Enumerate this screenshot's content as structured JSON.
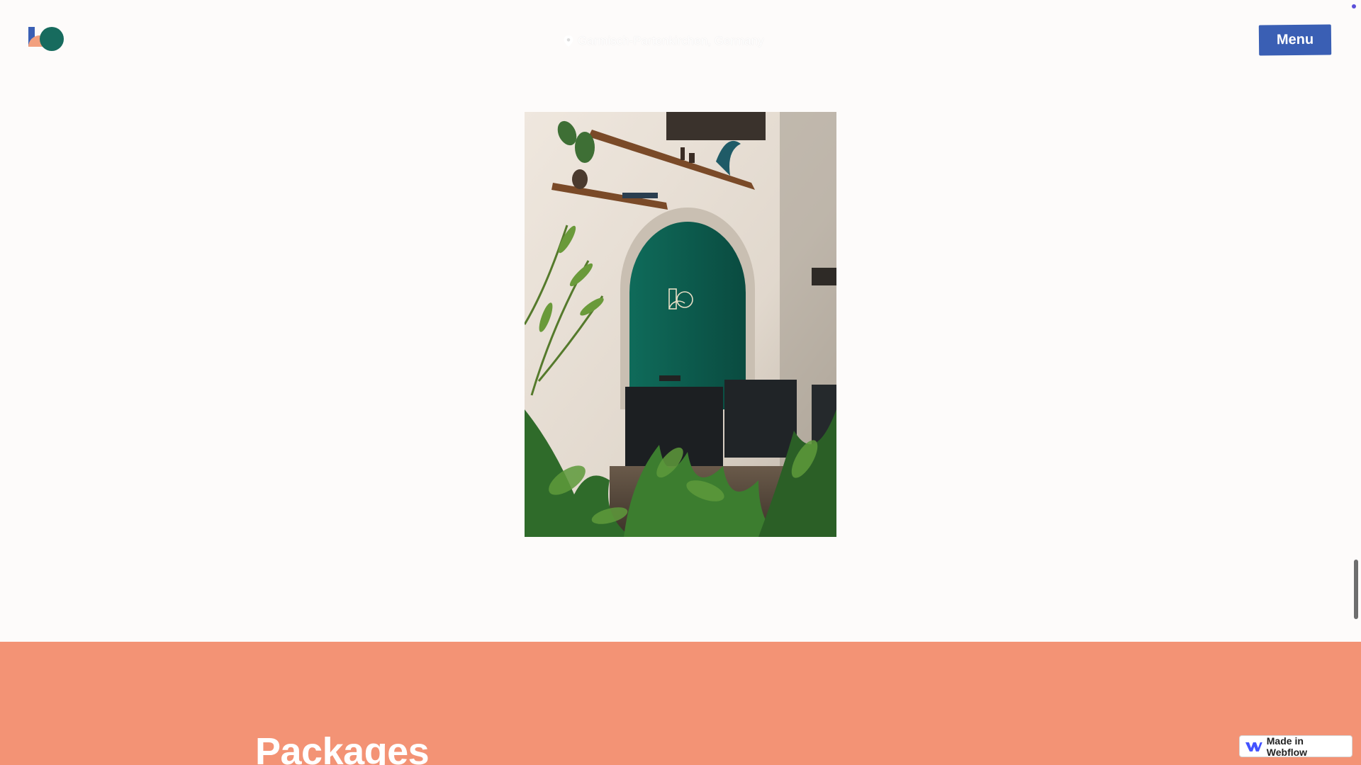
{
  "header": {
    "location_text": "Garmisch-Partenkirchen, Germany",
    "menu_label": "Menu"
  },
  "packages": {
    "title": "Packages"
  },
  "badge": {
    "label": "Made in Webflow"
  },
  "colors": {
    "background": "#fdfbfa",
    "accent_blue": "#3a5fb4",
    "packages_bg": "#f39375",
    "logo_teal": "#176b5e",
    "logo_peach": "#f2a07e"
  },
  "icons": [
    "logo-icon",
    "location-pin-icon",
    "webflow-icon"
  ]
}
